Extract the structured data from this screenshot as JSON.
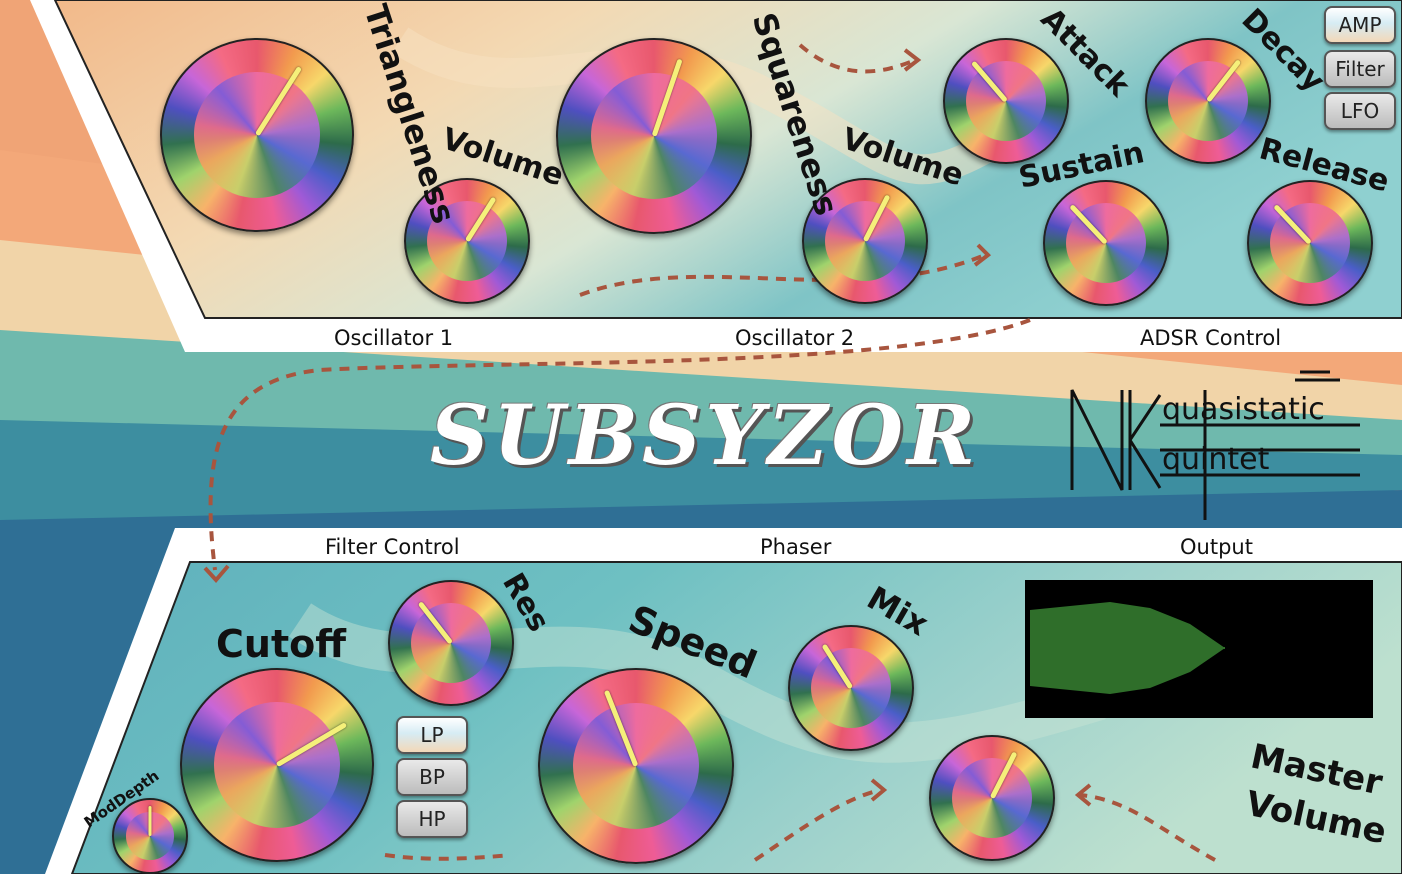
{
  "app": {
    "title": "SUBSYZOR",
    "logo_text": [
      "N",
      "quasistatic",
      "quintet"
    ]
  },
  "sections": {
    "oscillator1": "Oscillator 1",
    "oscillator2": "Oscillator 2",
    "adsr": "ADSR Control",
    "filter": "Filter Control",
    "phaser": "Phaser",
    "output": "Output"
  },
  "knobs": {
    "triangleness": "Triangleness",
    "osc1_volume": "Volume",
    "squareness": "Squareness",
    "osc2_volume": "Volume",
    "attack": "Attack",
    "decay": "Decay",
    "sustain": "Sustain",
    "release": "Release",
    "cutoff": "Cutoff",
    "res": "Res",
    "mod_depth": "ModDepth",
    "speed": "Speed",
    "mix": "Mix",
    "master_volume_line1": "Master",
    "master_volume_line2": "Volume"
  },
  "knob_values": {
    "triangleness": 0.62,
    "osc1_volume": 0.62,
    "squareness": 0.57,
    "osc2_volume": 0.6,
    "attack": 0.35,
    "decay": 0.64,
    "sustain": 0.34,
    "release": 0.34,
    "cutoff": 0.72,
    "res": 0.36,
    "mod_depth": 0.5,
    "speed": 0.42,
    "mix": 0.38,
    "master_volume": 0.6
  },
  "envelope_buttons": [
    "AMP",
    "Filter",
    "LFO"
  ],
  "filter_type_buttons": [
    "LP",
    "BP",
    "HP"
  ],
  "active": {
    "envelope": "AMP",
    "filter_type": "LP"
  },
  "colors": {
    "pointer": "#f5f07a",
    "waveform": "#2f6e2a",
    "scope_bg": "#000000",
    "arrow": "#a8553e"
  }
}
